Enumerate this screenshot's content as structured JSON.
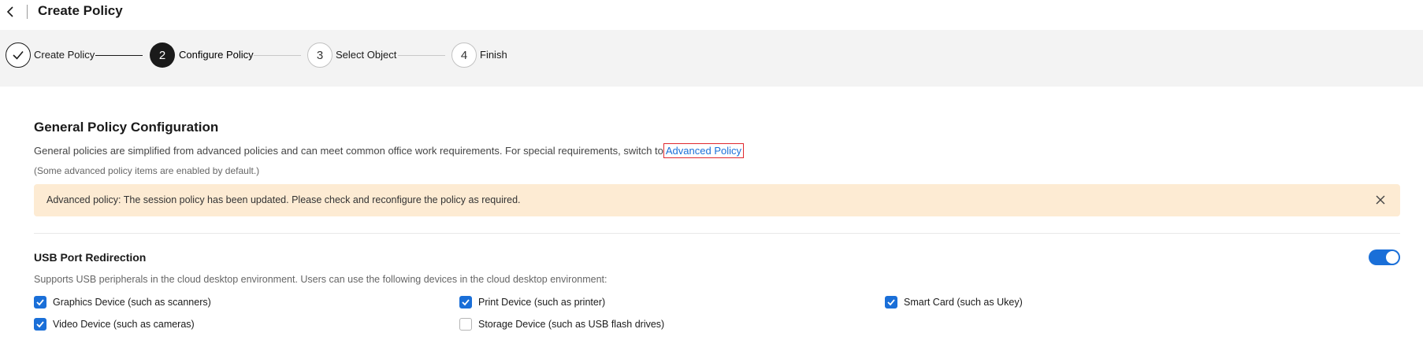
{
  "header": {
    "title": "Create Policy",
    "back_icon": "chevron-left-icon"
  },
  "stepper": {
    "steps": [
      {
        "number": "1",
        "label": "Create Policy",
        "status": "done"
      },
      {
        "number": "2",
        "label": "Configure Policy",
        "status": "active"
      },
      {
        "number": "3",
        "label": "Select Object",
        "status": "todo"
      },
      {
        "number": "4",
        "label": "Finish",
        "status": "todo"
      }
    ]
  },
  "general": {
    "title": "General Policy Configuration",
    "description": "General policies are simplified from advanced policies and can meet common office work requirements. For special requirements, switch to",
    "link_label": "Advanced Policy",
    "note": "(Some advanced policy items are enabled by default.)"
  },
  "alert": {
    "text": "Advanced policy: The session policy has been updated. Please check and reconfigure the policy as required."
  },
  "usb": {
    "title": "USB Port Redirection",
    "enabled": true,
    "description": "Supports USB peripherals in the cloud desktop environment. Users can use the following devices in the cloud desktop environment:",
    "devices": [
      {
        "label": "Graphics Device (such as scanners)",
        "checked": true
      },
      {
        "label": "Print Device (such as printer)",
        "checked": true
      },
      {
        "label": "Smart Card (such as Ukey)",
        "checked": true
      },
      {
        "label": "Video Device (such as cameras)",
        "checked": true
      },
      {
        "label": "Storage Device (such as USB flash drives)",
        "checked": false
      }
    ]
  },
  "colors": {
    "accent": "#1a6fd8",
    "alert_bg": "#fdebd3",
    "step_active": "#1a1a1a",
    "link_outline": "#e0282e"
  }
}
